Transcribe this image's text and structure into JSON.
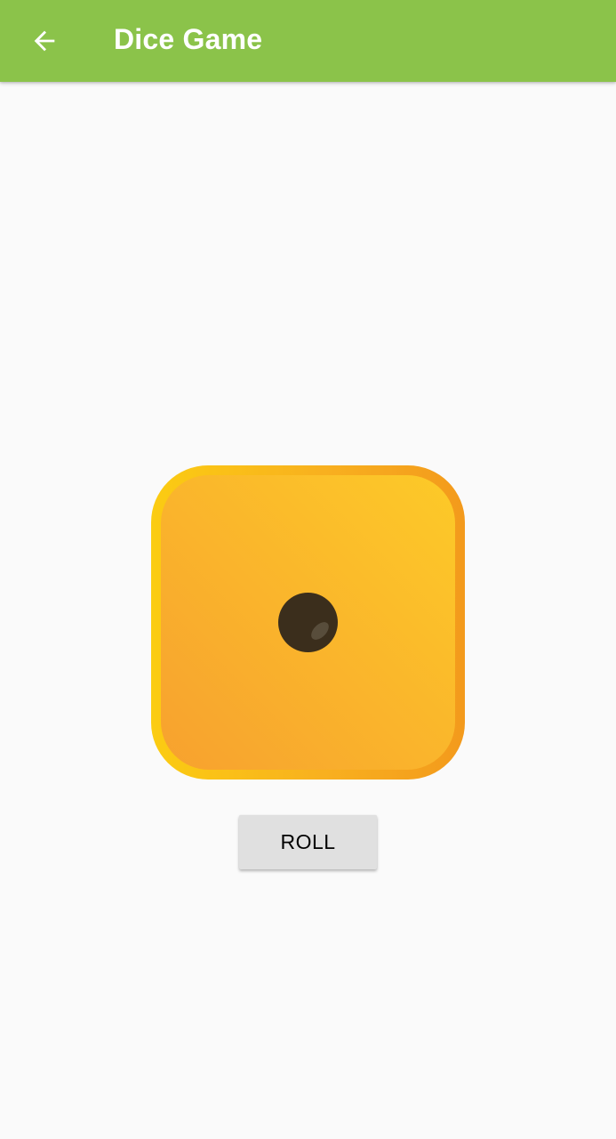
{
  "app_bar": {
    "title": "Dice Game",
    "back_icon": "arrow-back-icon",
    "background_color": "#8bc34a",
    "text_color": "#ffffff"
  },
  "dice": {
    "face_value": 1,
    "icon": "dice-face-one-icon",
    "colors": {
      "body_light": "#fdca28",
      "body_dark": "#f7a12f",
      "rim_left": "#fbcc12",
      "rim_right": "#f39a1c",
      "pip": "#3b2e1c"
    }
  },
  "roll_button": {
    "label": "ROLL",
    "background_color": "#e0e0e0"
  },
  "page": {
    "background_color": "#fafafa"
  }
}
